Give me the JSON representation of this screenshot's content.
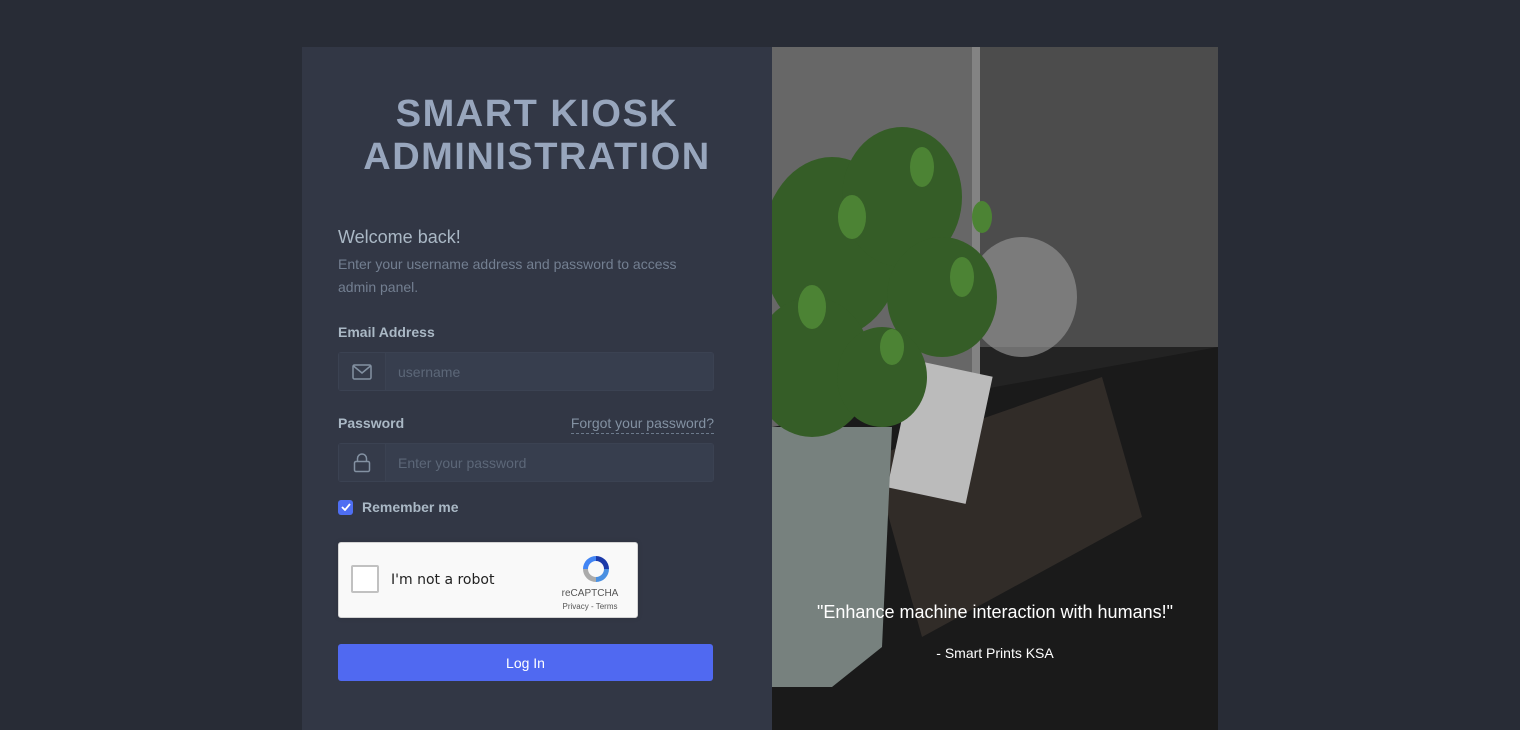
{
  "left": {
    "title": "SMART KIOSK ADMINISTRATION",
    "welcome": "Welcome back!",
    "subtitle": "Enter your username address and password to access admin panel.",
    "email_label": "Email Address",
    "email_placeholder": "username",
    "password_label": "Password",
    "forgot_link": "Forgot your password?",
    "password_placeholder": "Enter your password",
    "remember_label": "Remember me",
    "remember_checked": true,
    "recaptcha": {
      "label": "I'm not a robot",
      "brand": "reCAPTCHA",
      "links": "Privacy - Terms"
    },
    "login_button": "Log In"
  },
  "right": {
    "quote": "\"Enhance machine interaction with humans!\"",
    "author": "- Smart Prints KSA"
  },
  "colors": {
    "page_bg": "#282c36",
    "panel_bg": "#323745",
    "accent": "#5069f1",
    "title": "#98a6bd"
  },
  "icons": {
    "email": "mail-icon",
    "password": "lock-icon",
    "checkbox": "check-icon",
    "recaptcha": "recaptcha-logo-icon"
  }
}
